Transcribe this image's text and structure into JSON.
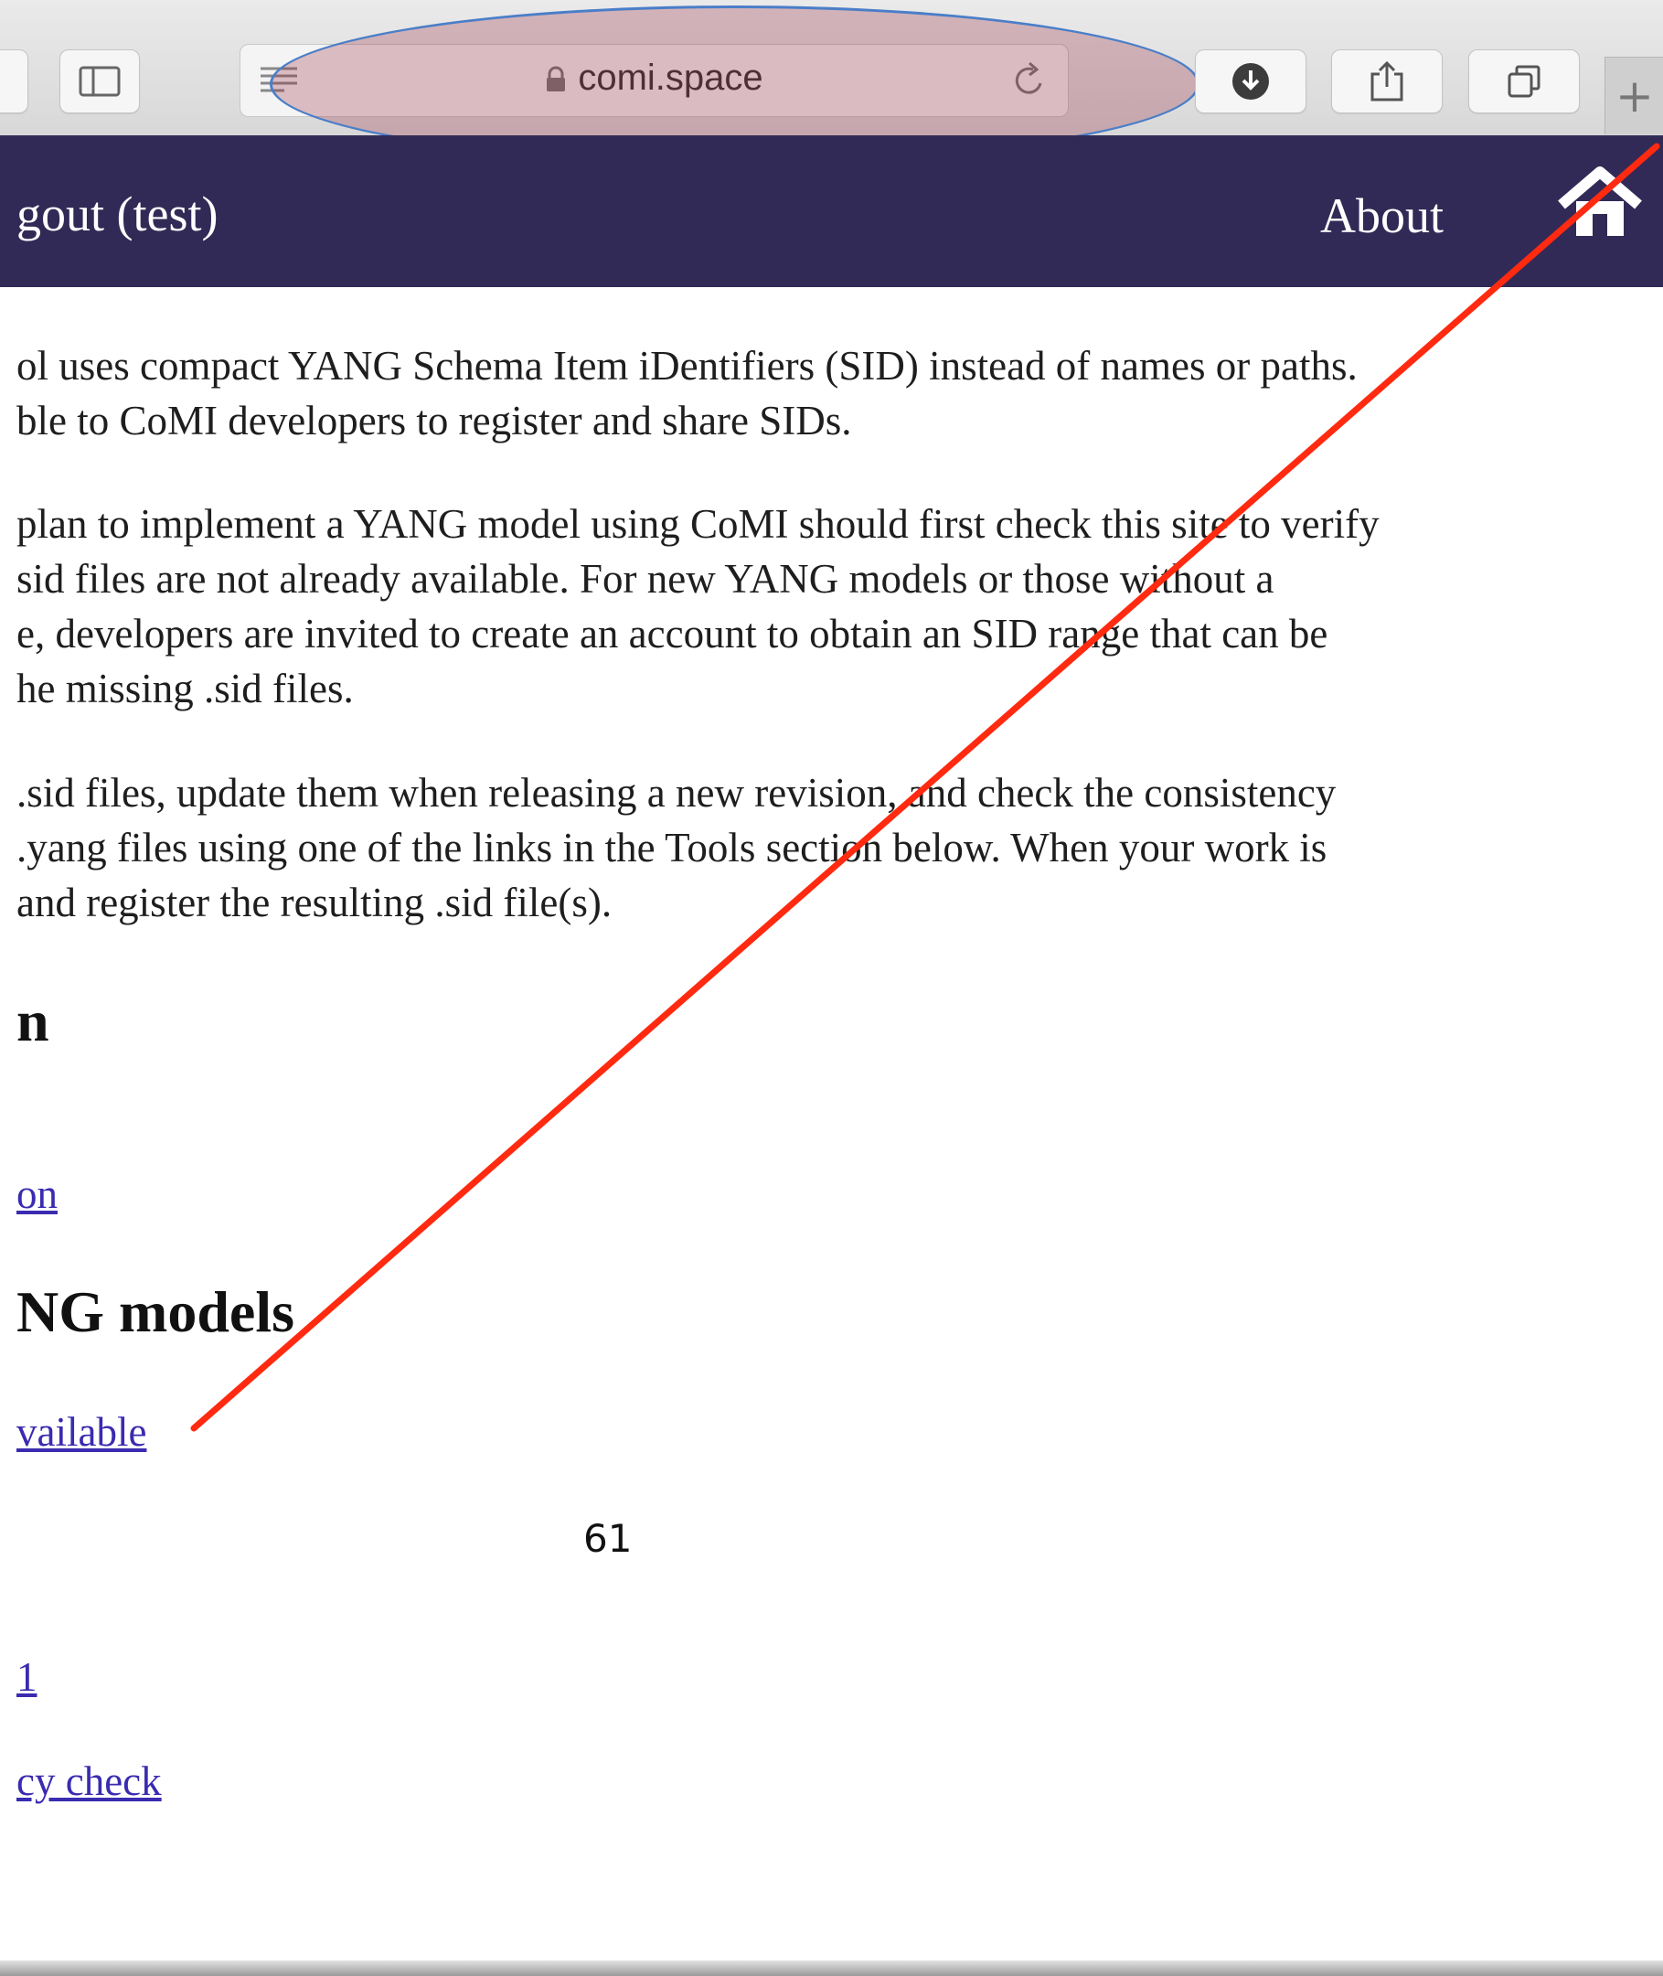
{
  "browser": {
    "url": "comi.space",
    "icons": {
      "sidebar": "sidebar-icon",
      "reader": "reader-icon",
      "lock": "lock-icon",
      "reload": "reload-icon",
      "downloads": "download-icon",
      "share": "share-icon",
      "tabs": "tabs-icon",
      "new_tab": "plus-icon"
    },
    "new_tab_label": "+"
  },
  "nav": {
    "logout_label": "gout (test)",
    "about_label": "About",
    "home_icon": "home-icon",
    "background_color": "#322a56"
  },
  "content": {
    "paragraphs": [
      [
        "ol uses compact YANG Schema Item iDentifiers (SID) instead of names or paths.",
        "ble to CoMI developers to register and share SIDs."
      ],
      [
        "plan to implement a YANG model using CoMI should first check this site to verify",
        "sid files are not already available. For new YANG models or those without a",
        "e, developers are invited to create an account to obtain an SID range that can be",
        "he missing .sid files."
      ],
      [
        ".sid files, update them when releasing a new revision, and check the consistency",
        ".yang files using one of the links in the Tools section below. When your work is",
        " and register the resulting .sid file(s)."
      ]
    ],
    "heading_1": "n",
    "link_1": "on",
    "heading_2": "NG models",
    "link_2": "vailable",
    "link_3": "1",
    "link_4": "cy check"
  },
  "slide": {
    "page_number": "61",
    "annotation_color": "#ff2a10",
    "highlight_color": "#962838"
  }
}
